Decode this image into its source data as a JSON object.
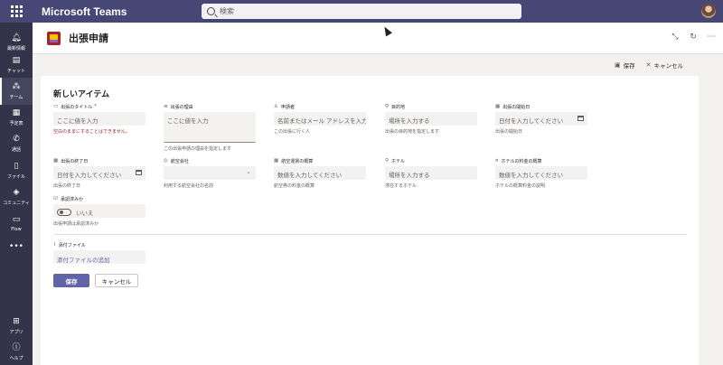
{
  "app": {
    "title": "Microsoft Teams"
  },
  "search": {
    "placeholder": "検索"
  },
  "rail": {
    "top_items": [
      {
        "label": "最新情報",
        "icon": "bell-icon"
      },
      {
        "label": "チャット",
        "icon": "chat-icon"
      },
      {
        "label": "チーム",
        "icon": "teams-icon",
        "active": true
      },
      {
        "label": "予定表",
        "icon": "calendar-icon"
      },
      {
        "label": "通話",
        "icon": "phone-icon"
      },
      {
        "label": "ファイル",
        "icon": "file-icon"
      },
      {
        "label": "コミュニティ",
        "icon": "community-icon"
      },
      {
        "label": "Flow",
        "icon": "flow-icon"
      },
      {
        "label": "",
        "icon": "more-icon"
      }
    ],
    "bottom_items": [
      {
        "label": "アプリ",
        "icon": "apps-icon"
      },
      {
        "label": "ヘルプ",
        "icon": "help-icon"
      }
    ]
  },
  "header": {
    "title": "出張申請"
  },
  "commands": {
    "save": "保存",
    "cancel": "キャンセル"
  },
  "form": {
    "title": "新しいアイテム",
    "fields": {
      "title": {
        "label": "出張のタイトル",
        "required_mark": "*",
        "placeholder": "ここに値を入力",
        "error": "空白のままにすることはできません。"
      },
      "reason": {
        "label": "出張の理由",
        "placeholder": "ここに値を入力",
        "help": "この出張申請の理由を指定します"
      },
      "applicant": {
        "label": "申請者",
        "placeholder": "名前またはメール アドレスを入力",
        "help": "この出張に行く人"
      },
      "destination": {
        "label": "目的地",
        "placeholder": "場所を入力する",
        "help": "出張の目的地を指定します"
      },
      "start_date": {
        "label": "出張の開始日",
        "placeholder": "日付を入力してください",
        "help": "出張の開始日"
      },
      "end_date": {
        "label": "出張の終了日",
        "placeholder": "日付を入力してください",
        "help": "出張の終了日"
      },
      "airline": {
        "label": "航空会社",
        "placeholder": "",
        "help": "利用する航空会社の名前"
      },
      "airfare": {
        "label": "航空運賃の概算",
        "placeholder": "数値を入力してください",
        "help": "航空券の料金の概算"
      },
      "hotel": {
        "label": "ホテル",
        "placeholder": "場所を入力する",
        "help": "滞在するホテル"
      },
      "hotel_cost": {
        "label": "ホテルの料金の概算",
        "placeholder": "数値を入力してください",
        "help": "ホテルの概算料金の説明"
      },
      "approved": {
        "label": "承認済みか",
        "value": "いいえ",
        "help": "出張申請は承認済みか"
      },
      "attachments": {
        "label": "添付ファイル",
        "link": "添付ファイルの追加"
      }
    },
    "buttons": {
      "save": "保存",
      "cancel": "キャンセル"
    }
  }
}
